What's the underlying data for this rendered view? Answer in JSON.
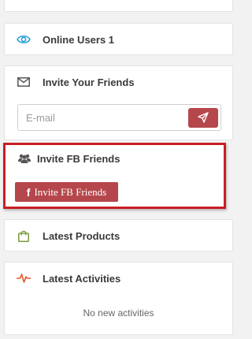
{
  "online_users": {
    "label": "Online Users 1"
  },
  "invite_friends": {
    "title": "Invite Your Friends",
    "email_placeholder": "E-mail"
  },
  "invite_fb": {
    "title": "Invite FB Friends",
    "button_icon": "f",
    "button_label": "Invite FB Friends"
  },
  "latest_products": {
    "title": "Latest Products"
  },
  "latest_activities": {
    "title": "Latest Activities",
    "empty_text": "No new activities"
  },
  "colors": {
    "accent": "#b5474c",
    "highlight_border": "#c81e24",
    "eye_icon": "#2a9fd6",
    "activity_icon": "#e35a2b",
    "products_icon": "#7a9a3a",
    "mail_icon": "#555555"
  },
  "icons": {
    "online_users": "eye-icon",
    "invite_friends": "envelope-icon",
    "send": "paper-plane-icon",
    "invite_fb": "users-icon",
    "latest_products": "shopping-bag-icon",
    "latest_activities": "heartbeat-icon"
  }
}
